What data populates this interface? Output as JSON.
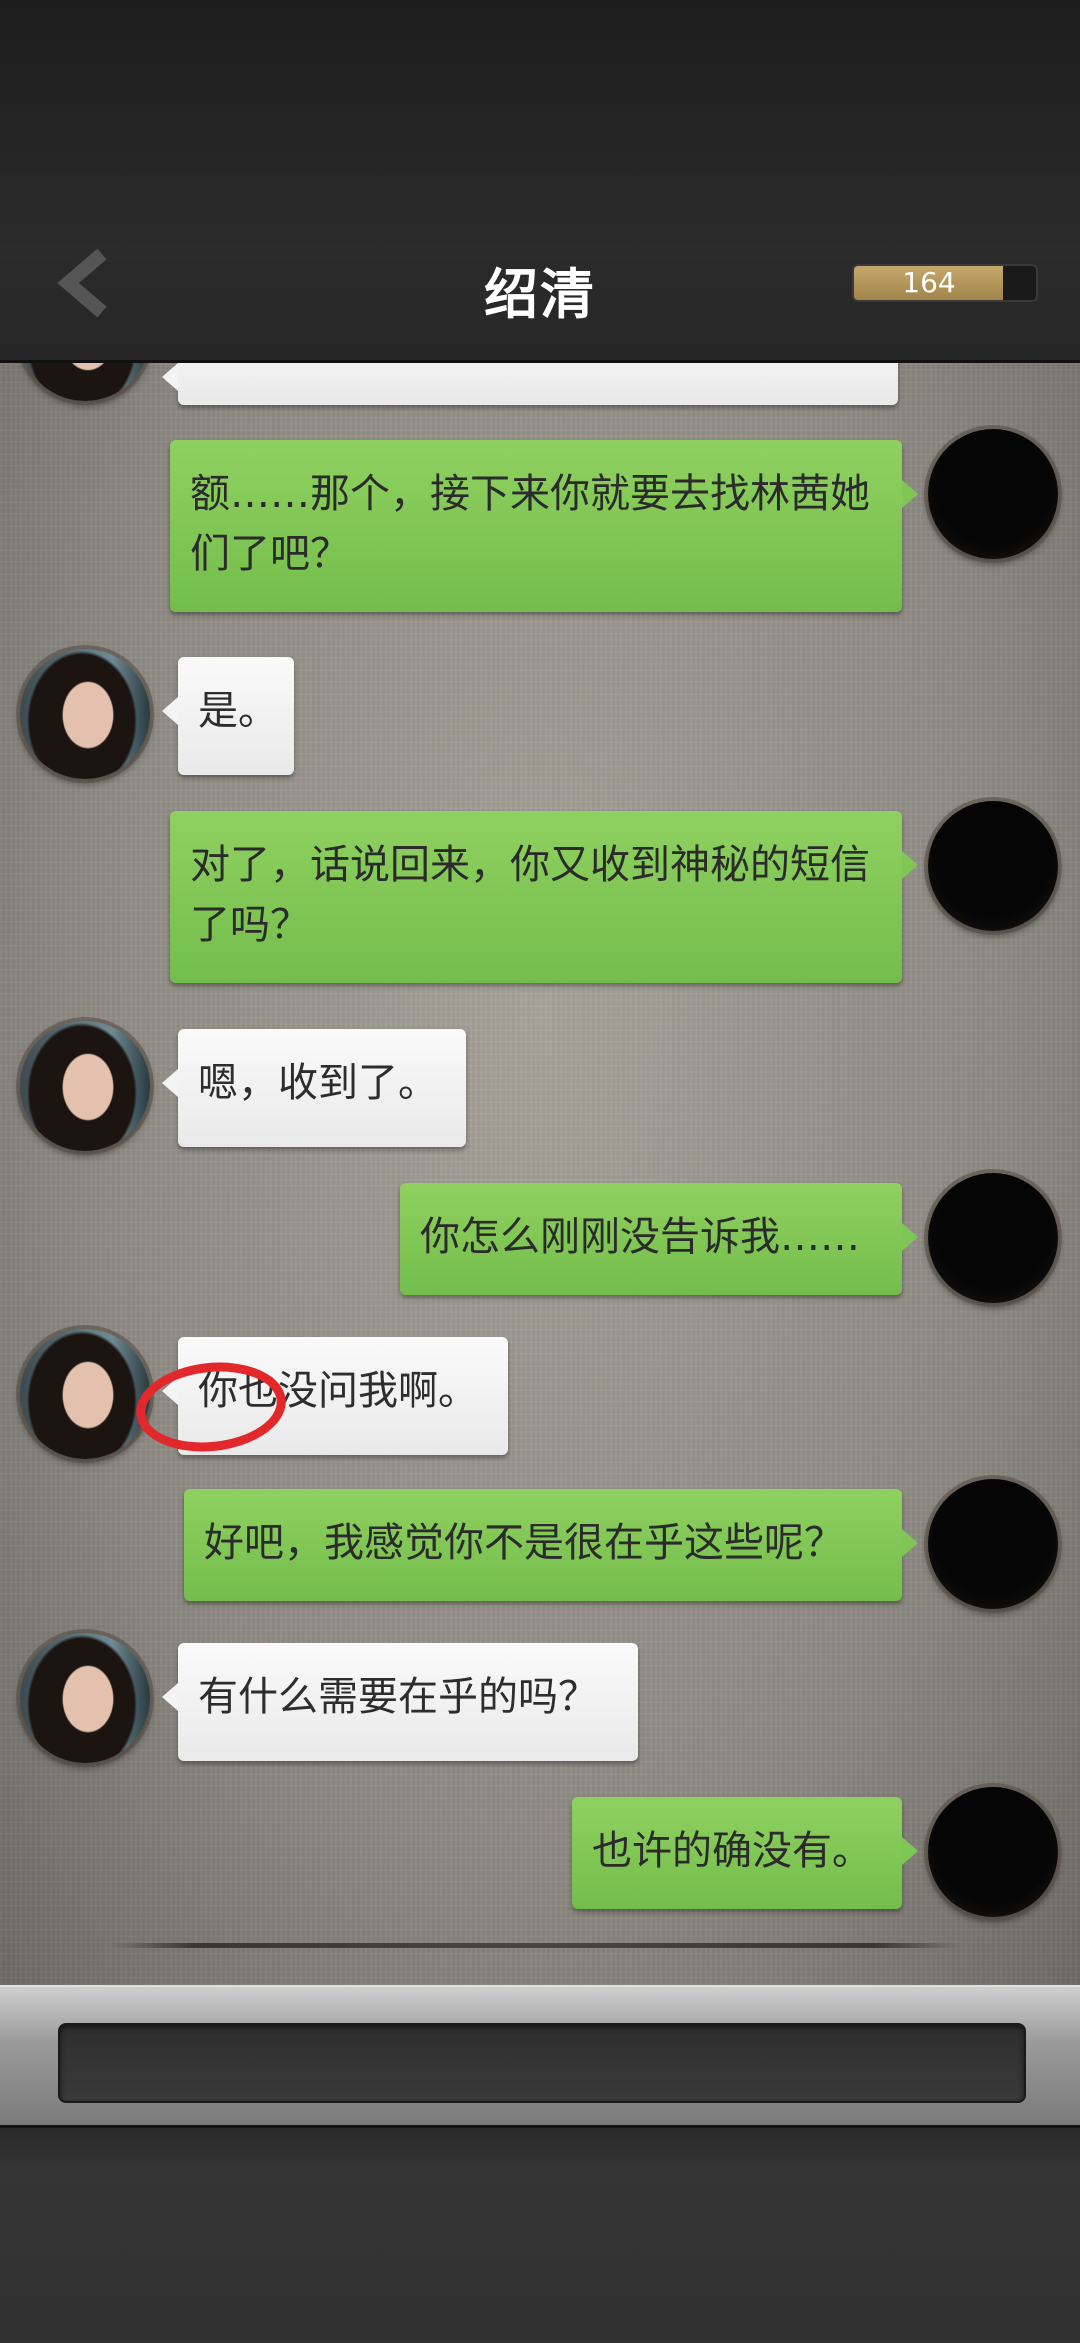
{
  "header": {
    "title": "绍清",
    "meter_value": "164",
    "meter_fill_fraction": 0.82,
    "back_icon": "chevron-left-icon"
  },
  "messages": [
    {
      "side": "left",
      "text": ""
    },
    {
      "side": "right",
      "text": "额……那个，接下来你就要去找林茜她们了吧？"
    },
    {
      "side": "left",
      "text": "是。"
    },
    {
      "side": "right",
      "text": "对了，话说回来，你又收到神秘的短信了吗？"
    },
    {
      "side": "left",
      "text": "嗯，收到了。"
    },
    {
      "side": "right",
      "text": "你怎么刚刚没告诉我……"
    },
    {
      "side": "left",
      "text": "你也没问我啊。"
    },
    {
      "side": "right",
      "text": "好吧，我感觉你不是很在乎这些呢？"
    },
    {
      "side": "left",
      "text": "有什么需要在乎的吗？"
    },
    {
      "side": "right",
      "text": "也许的确没有。"
    }
  ],
  "colors": {
    "bubble_left": "#f3f3f3",
    "bubble_right": "#80c656",
    "highlight_circle": "#e3282b",
    "header_bg": "#222222"
  }
}
